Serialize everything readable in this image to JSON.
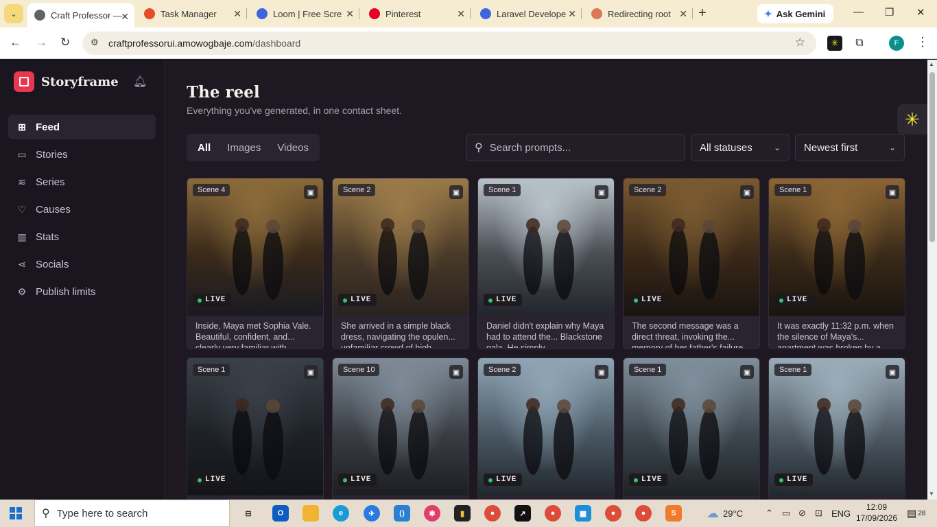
{
  "browser": {
    "tabs": [
      {
        "title": "Craft Professor —",
        "color": "#5f6368",
        "active": true
      },
      {
        "title": "Task Manager",
        "color": "#e44d26",
        "active": false
      },
      {
        "title": "Loom | Free Scre",
        "color": "#3e64de",
        "active": false
      },
      {
        "title": "Pinterest",
        "color": "#e60023",
        "active": false
      },
      {
        "title": "Laravel Develope",
        "color": "#3e64de",
        "active": false
      },
      {
        "title": "Redirecting root",
        "color": "#d97757",
        "active": false
      }
    ],
    "gemini_label": "Ask Gemini",
    "url_host": "craftprofessorui.amowogbaje.com",
    "url_path": "/dashboard",
    "profile_initial": "F"
  },
  "app": {
    "brand": "Storyframe",
    "nav": [
      {
        "label": "Feed",
        "icon": "grid-icon",
        "glyph": "⊞",
        "active": true
      },
      {
        "label": "Stories",
        "icon": "book-icon",
        "glyph": "▭",
        "active": false
      },
      {
        "label": "Series",
        "icon": "layers-icon",
        "glyph": "≋",
        "active": false
      },
      {
        "label": "Causes",
        "icon": "heart-icon",
        "glyph": "♡",
        "active": false
      },
      {
        "label": "Stats",
        "icon": "bar-chart-icon",
        "glyph": "▥",
        "active": false
      },
      {
        "label": "Socials",
        "icon": "share-icon",
        "glyph": "⋖",
        "active": false
      },
      {
        "label": "Publish limits",
        "icon": "settings-icon",
        "glyph": "⚙",
        "active": false
      }
    ],
    "page_title": "The reel",
    "page_subtitle": "Everything you've generated, in one contact sheet.",
    "filters": {
      "tabs": [
        "All",
        "Images",
        "Videos"
      ],
      "active_tab": "All",
      "search_placeholder": "Search prompts...",
      "status_select": "All statuses",
      "sort_select": "Newest first"
    },
    "cards": [
      {
        "scene": "Scene 4",
        "status": "LIVE",
        "caption": "Inside, Maya met Sophia Vale. Beautiful, confident, and... clearly very familiar with",
        "palette": [
          "#8a6a3a",
          "#3a2a1a",
          "#1a1a22"
        ]
      },
      {
        "scene": "Scene 2",
        "status": "LIVE",
        "caption": "She arrived in a simple black dress, navigating the opulen... unfamiliar crowd of high",
        "palette": [
          "#9a7a48",
          "#4a3a28",
          "#2a2220"
        ]
      },
      {
        "scene": "Scene 1",
        "status": "LIVE",
        "caption": "Daniel didn't explain why Maya had to attend the... Blackstone gala. He simply",
        "palette": [
          "#b7c2c8",
          "#4a4e55",
          "#22262c"
        ]
      },
      {
        "scene": "Scene 2",
        "status": "LIVE",
        "caption": "The second message was a direct threat, invoking the... memory of her father's failure",
        "palette": [
          "#7a5a30",
          "#3a2818",
          "#1a1410"
        ]
      },
      {
        "scene": "Scene 1",
        "status": "LIVE",
        "caption": "It was exactly 11:32 p.m. when the silence of Maya's... apartment was broken by a",
        "palette": [
          "#8a6534",
          "#3a2a18",
          "#1a1410"
        ]
      },
      {
        "scene": "Scene 1",
        "status": "LIVE",
        "caption": "",
        "palette": [
          "#3a4048",
          "#1e2228",
          "#121418"
        ]
      },
      {
        "scene": "Scene 10",
        "status": "LIVE",
        "caption": "",
        "palette": [
          "#7d8a96",
          "#3a3e44",
          "#1c1e22"
        ]
      },
      {
        "scene": "Scene 2",
        "status": "LIVE",
        "caption": "",
        "palette": [
          "#8fa4b4",
          "#4a5864",
          "#22282e"
        ]
      },
      {
        "scene": "Scene 1",
        "status": "LIVE",
        "caption": "",
        "palette": [
          "#7e8e9a",
          "#3e4850",
          "#1e2226"
        ]
      },
      {
        "scene": "Scene 1",
        "status": "LIVE",
        "caption": "",
        "palette": [
          "#9aacb8",
          "#4e5a64",
          "#22282e"
        ]
      }
    ]
  },
  "taskbar": {
    "search_placeholder": "Type here to search",
    "weather": "29°C",
    "language": "ENG",
    "time": "12:09",
    "date": "17/09/2026",
    "notifications": "28"
  }
}
